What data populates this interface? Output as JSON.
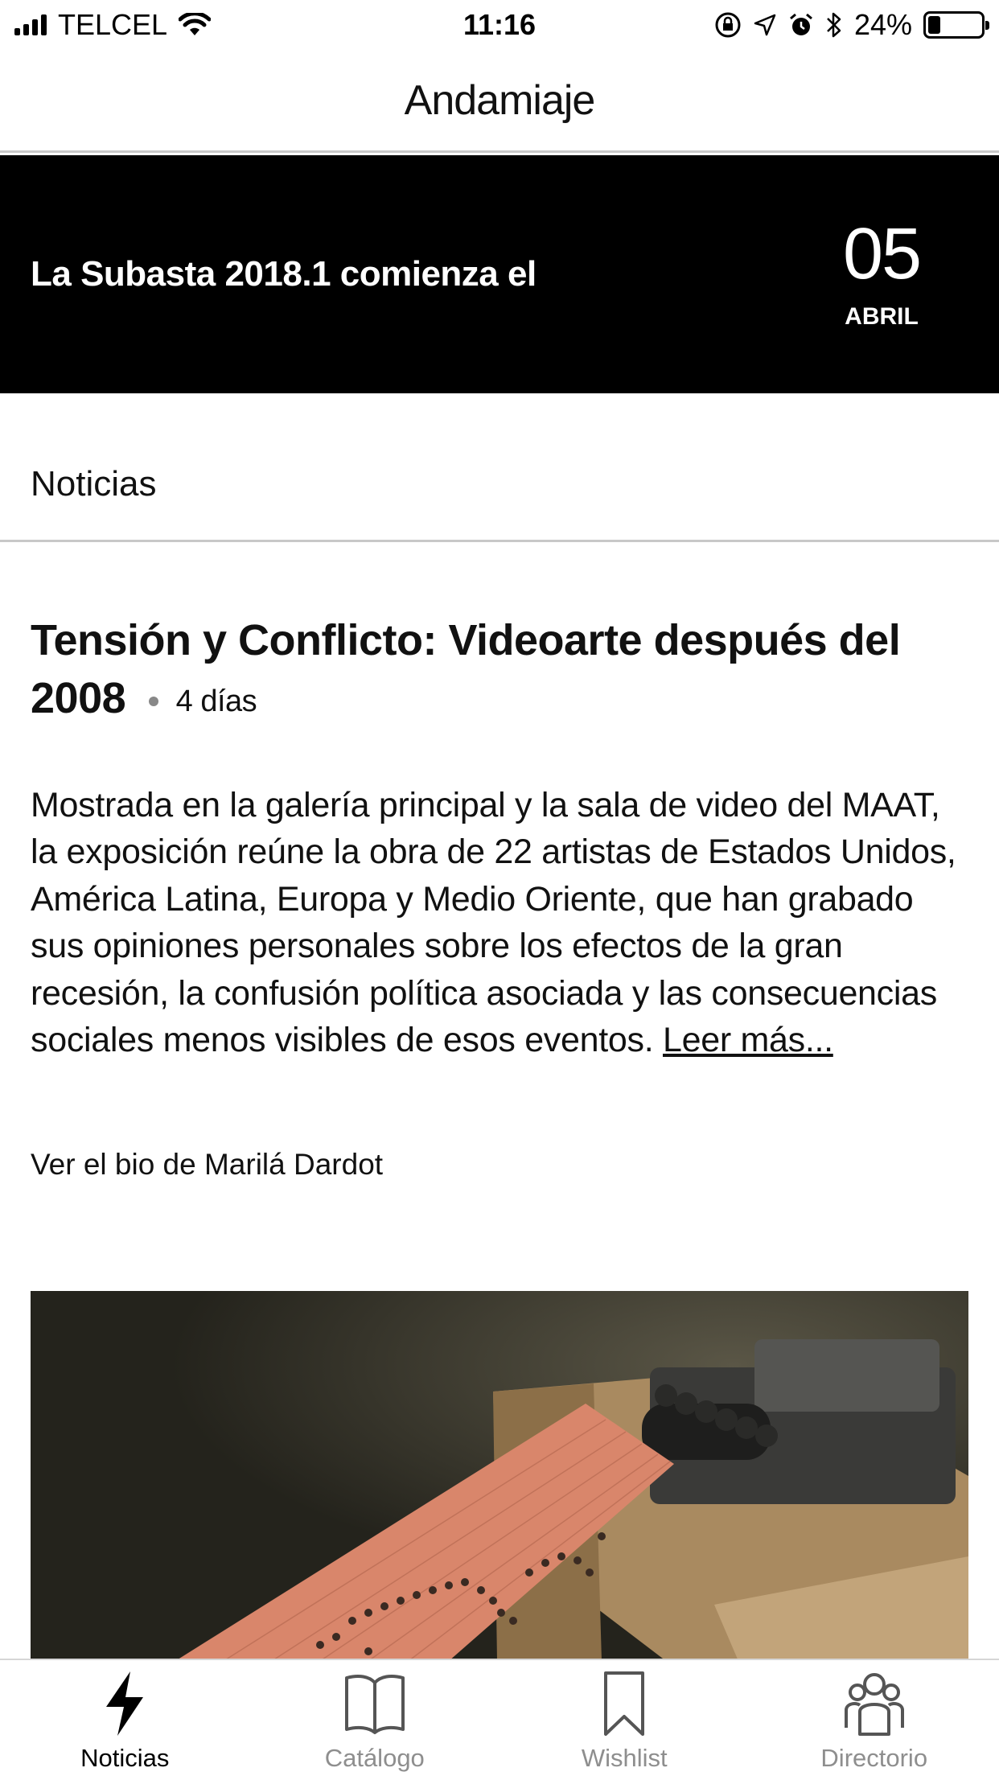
{
  "status_bar": {
    "carrier": "TELCEL",
    "time": "11:16",
    "battery_percent_text": "24%",
    "battery_level": 0.24
  },
  "header": {
    "title": "Andamiaje"
  },
  "banner": {
    "text": "La Subasta 2018.1 comienza el",
    "day": "05",
    "month": "ABRIL"
  },
  "section": {
    "title": "Noticias"
  },
  "article": {
    "title": "Tensión y Conflicto: Videoarte después del 2008",
    "age": "4 días",
    "body": "Mostrada en la galería principal y la sala de video del MAAT, la exposición reúne la obra de 22 artistas de Estados Unidos, América Latina, Europa y Medio Oriente, que han grabado sus opiniones personales sobre los efectos de la gran recesión, la confusión política asociada y las consecuencias sociales menos visibles de esos eventos.",
    "read_more": "Leer más...",
    "bio_link": "Ver el bio de Marilá Dardot"
  },
  "tabs": [
    {
      "label": "Noticias",
      "icon": "bolt-icon",
      "active": true
    },
    {
      "label": "Catálogo",
      "icon": "book-icon",
      "active": false
    },
    {
      "label": "Wishlist",
      "icon": "bookmark-icon",
      "active": false
    },
    {
      "label": "Directorio",
      "icon": "people-icon",
      "active": false
    }
  ],
  "colors": {
    "banner_bg": "#000000",
    "active_tab": "#000000",
    "inactive_tab": "#8e8e8e",
    "divider": "#c8c8c8"
  }
}
